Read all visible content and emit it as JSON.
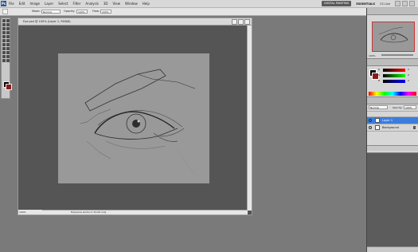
{
  "app": {
    "logo": "Ps"
  },
  "menu": {
    "items": [
      "File",
      "Edit",
      "Image",
      "Layer",
      "Select",
      "Filter",
      "Analysis",
      "3D",
      "View",
      "Window",
      "Help"
    ]
  },
  "menubar_right": {
    "workspace_button": "DIGITAL PAINTING",
    "essentials": "ESSENTIALS",
    "cs_live": "CS Live"
  },
  "options": {
    "mode_label": "Mode:",
    "mode_value": "Normal",
    "opacity_label": "Opacity:",
    "opacity_value": "100%",
    "flow_label": "Flow:",
    "flow_value": "100%"
  },
  "document": {
    "title": "Eye.psd @ 100% (Layer 1, RGB/8)",
    "zoom": "100%",
    "status": "Exposure works in 32-bit only"
  },
  "navigator": {
    "tab": "NAVIGATOR",
    "zoom": "100%"
  },
  "color": {
    "tab_color": "COLOR",
    "tab_swatches": "SWATCHES",
    "r_label": "R",
    "g_label": "G",
    "b_label": "B",
    "r_value": "0",
    "g_value": "0",
    "b_value": "0"
  },
  "layers": {
    "tab": "LAYERS",
    "blend_mode": "Normal",
    "opacity_label": "Opacity:",
    "opacity_value": "100%",
    "rows": [
      {
        "name": "Layer 1",
        "selected": true
      },
      {
        "name": "Background",
        "selected": false
      }
    ]
  },
  "colors": {
    "accent": "#3b7ddd",
    "canvas": "#999999",
    "workspace": "#7a7a7a"
  },
  "icons": {
    "brush": "brush-icon",
    "eye": "eye-icon",
    "lock": "lock-icon"
  }
}
